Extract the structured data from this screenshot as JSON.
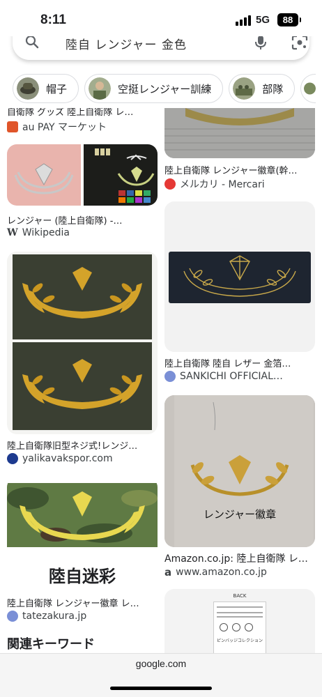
{
  "status_bar": {
    "time": "8:11",
    "network": "5G",
    "battery": "88"
  },
  "search": {
    "query": "陸自 レンジャー 金色"
  },
  "chips": [
    {
      "label": "帽子",
      "thumb_color": "#5a5a4a"
    },
    {
      "label": "空挺レンジャー訓練",
      "thumb_color": "#7a8a6a"
    },
    {
      "label": "部隊",
      "thumb_color": "#6a7a5a"
    }
  ],
  "results": {
    "left": [
      {
        "caption": "自衛隊 グッズ 陸上自衛隊 レ…",
        "source": "au PAY マーケット",
        "fav": "#e0552a"
      },
      {
        "caption": "レンジャー (陸上自衛隊) -…",
        "source": "Wikipedia",
        "fav_text": "W"
      },
      {
        "caption": "陸上自衛隊旧型ネジ式!レンジ…",
        "source": "yalikavakspor.com",
        "fav": "#1d3a8f"
      },
      {
        "caption": "陸上自衛隊 レンジャー徽章 レ…",
        "source": "tatezakura.jp",
        "fav": "#7a8fd6",
        "image_label": "陸自迷彩"
      }
    ],
    "right": [
      {
        "caption": "陸上自衛隊 レンジャー徽章(幹…",
        "source": "メルカリ - Mercari",
        "fav": "#e53935"
      },
      {
        "caption": "陸上自衛隊 陸自 レザー 金箔…",
        "source": "SANKICHI OFFICIAL…",
        "fav": "#7a8fd6"
      },
      {
        "caption": "Amazon.co.jp: 陸上自衛隊 レ…",
        "source": "www.amazon.co.jp",
        "fav_text": "a",
        "image_label": "レンジャー徽章"
      },
      {
        "card_header": "BACK",
        "card_text": "ピンバッジコレクション"
      }
    ]
  },
  "related_heading": "関連キーワード",
  "bottom_bar": {
    "domain": "google.com"
  }
}
